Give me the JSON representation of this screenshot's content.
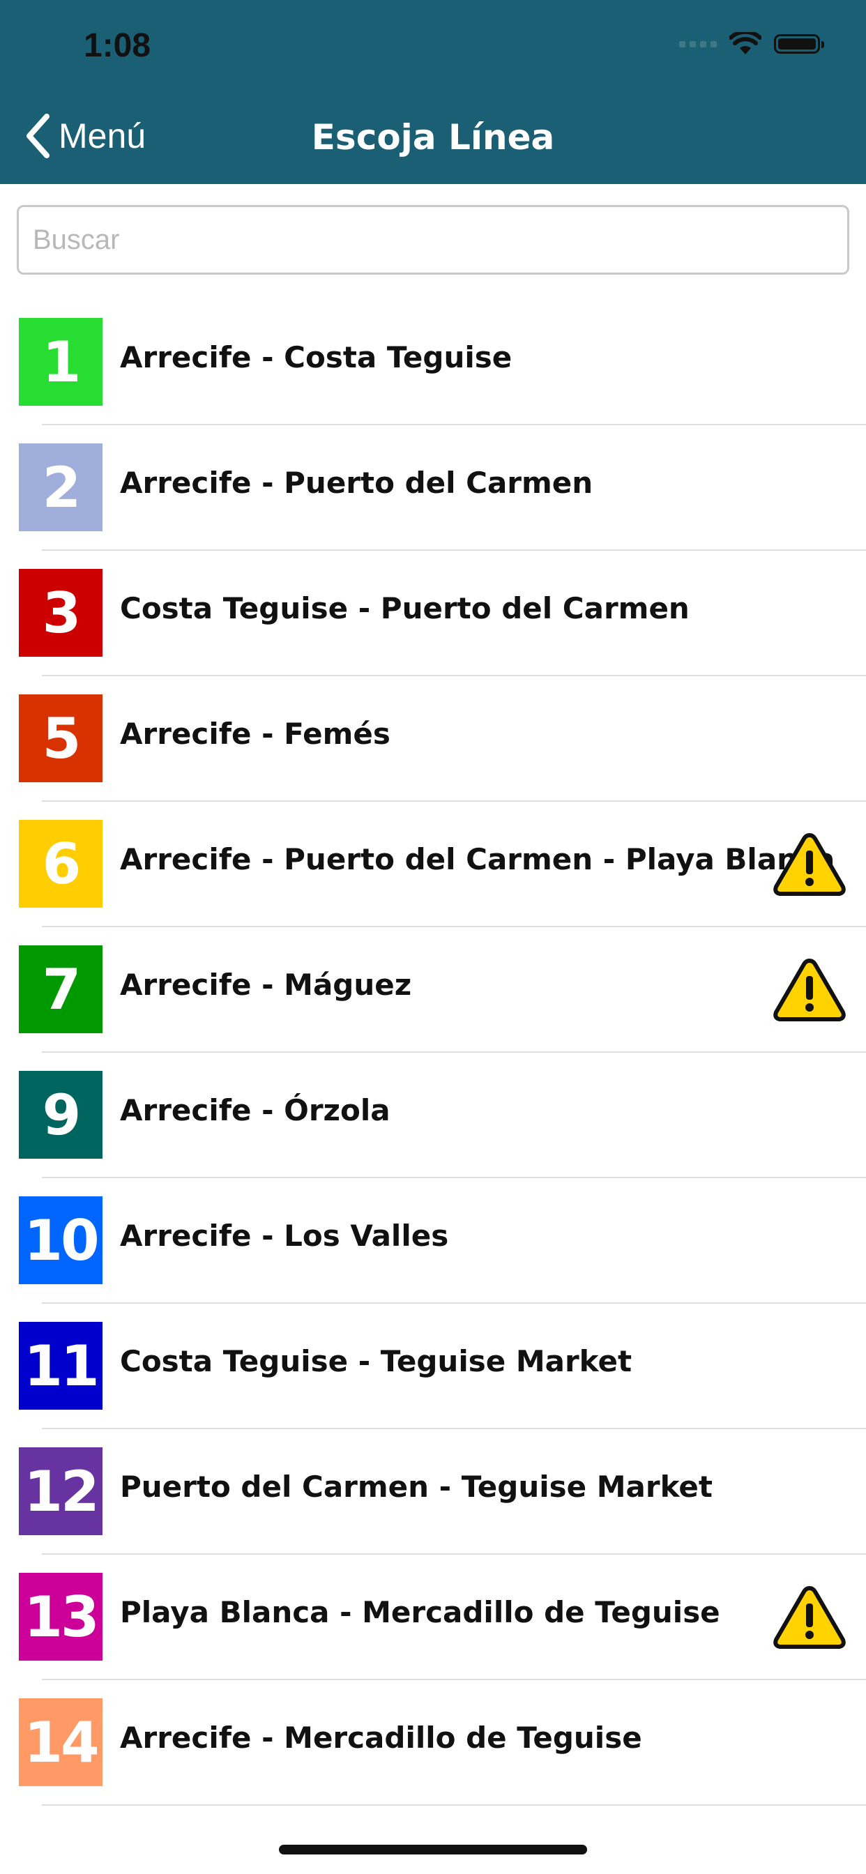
{
  "status_bar": {
    "time": "1:08"
  },
  "nav": {
    "back_label": "Menú",
    "title": "Escoja Línea"
  },
  "search": {
    "placeholder": "Buscar",
    "value": ""
  },
  "routes": [
    {
      "number": "1",
      "label": "Arrecife - Costa Teguise",
      "color": "#27dd32",
      "warning": false
    },
    {
      "number": "2",
      "label": "Arrecife - Puerto del Carmen",
      "color": "#9faedb",
      "warning": false
    },
    {
      "number": "3",
      "label": "Costa Teguise - Puerto del Carmen",
      "color": "#cc0000",
      "warning": false
    },
    {
      "number": "5",
      "label": "Arrecife - Femés",
      "color": "#d73200",
      "warning": false
    },
    {
      "number": "6",
      "label": "Arrecife - Puerto del Carmen - Playa Blanca",
      "color": "#ffcd00",
      "warning": true
    },
    {
      "number": "7",
      "label": "Arrecife - Máguez",
      "color": "#009900",
      "warning": true
    },
    {
      "number": "9",
      "label": "Arrecife - Órzola",
      "color": "#00655f",
      "warning": false
    },
    {
      "number": "10",
      "label": "Arrecife - Los Valles",
      "color": "#0066ff",
      "warning": false
    },
    {
      "number": "11",
      "label": "Costa Teguise - Teguise Market",
      "color": "#0000cc",
      "warning": false
    },
    {
      "number": "12",
      "label": "Puerto del Carmen - Teguise Market",
      "color": "#6633a0",
      "warning": false
    },
    {
      "number": "13",
      "label": "Playa Blanca - Mercadillo de Teguise",
      "color": "#cc0099",
      "warning": true
    },
    {
      "number": "14",
      "label": "Arrecife - Mercadillo de Teguise",
      "color": "#ff9966",
      "warning": false
    }
  ],
  "colors": {
    "header": "#1a5f73",
    "warning_fill": "#ffd200"
  }
}
